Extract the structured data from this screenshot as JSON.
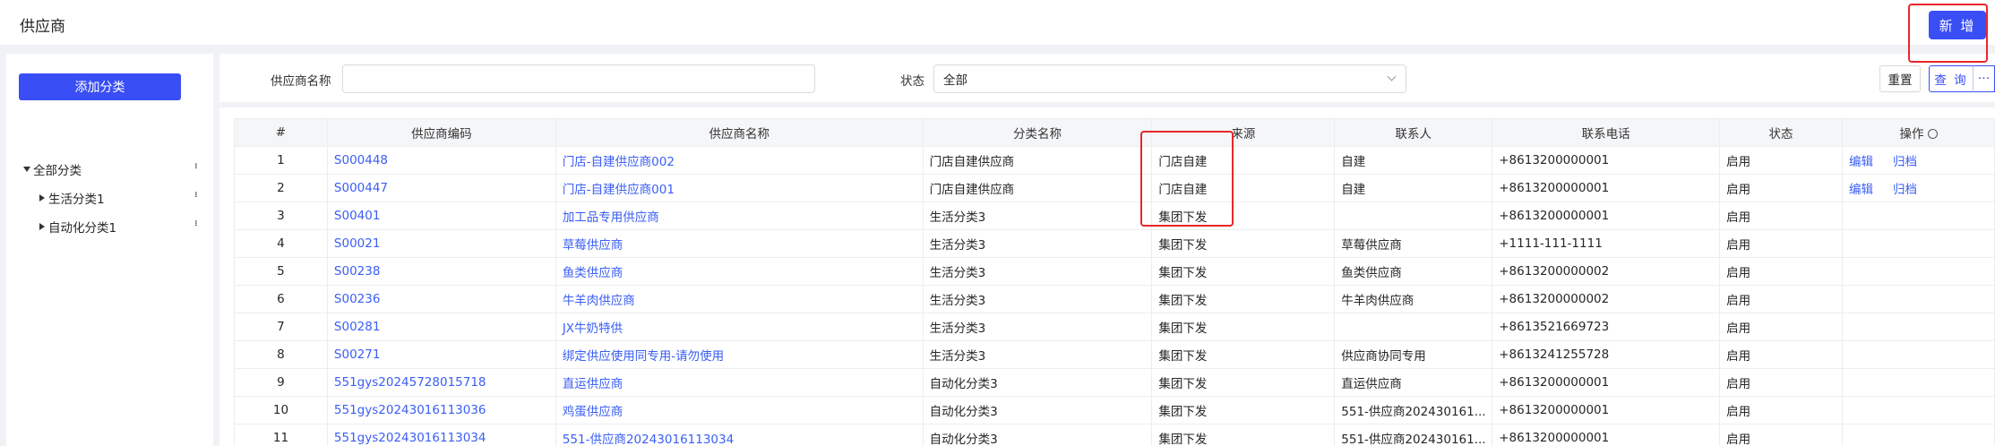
{
  "header": {
    "title": "供应商",
    "new_label": "新 增"
  },
  "sidebar": {
    "add_label": "添加分类",
    "tree": [
      {
        "label": "全部分类",
        "level": 0,
        "expanded": true
      },
      {
        "label": "生活分类1",
        "level": 1,
        "expanded": false
      },
      {
        "label": "自动化分类1",
        "level": 1,
        "expanded": false
      }
    ]
  },
  "filters": {
    "name_label": "供应商名称",
    "name_value": "",
    "status_label": "状态",
    "status_value": "全部",
    "reset_label": "重置",
    "query_label": "查 询",
    "more_label": "···"
  },
  "table": {
    "columns": [
      "#",
      "供应商编码",
      "供应商名称",
      "分类名称",
      "来源",
      "联系人",
      "联系电话",
      "状态",
      "操作"
    ],
    "actions": {
      "edit": "编辑",
      "archive": "归档"
    },
    "rows": [
      {
        "idx": "1",
        "code": "S000448",
        "name": "门店-自建供应商002",
        "category": "门店自建供应商",
        "source": "门店自建",
        "contact": "自建",
        "phone": "+8613200000001",
        "status": "启用",
        "ops": true
      },
      {
        "idx": "2",
        "code": "S000447",
        "name": "门店-自建供应商001",
        "category": "门店自建供应商",
        "source": "门店自建",
        "contact": "自建",
        "phone": "+8613200000001",
        "status": "启用",
        "ops": true
      },
      {
        "idx": "3",
        "code": "S00401",
        "name": "加工品专用供应商",
        "category": "生活分类3",
        "source": "集团下发",
        "contact": "",
        "phone": "+8613200000001",
        "status": "启用",
        "ops": false
      },
      {
        "idx": "4",
        "code": "S00021",
        "name": "草莓供应商",
        "category": "生活分类3",
        "source": "集团下发",
        "contact": "草莓供应商",
        "phone": "+1111-111-1111",
        "status": "启用",
        "ops": false
      },
      {
        "idx": "5",
        "code": "S00238",
        "name": "鱼类供应商",
        "category": "生活分类3",
        "source": "集团下发",
        "contact": "鱼类供应商",
        "phone": "+8613200000002",
        "status": "启用",
        "ops": false
      },
      {
        "idx": "6",
        "code": "S00236",
        "name": "牛羊肉供应商",
        "category": "生活分类3",
        "source": "集团下发",
        "contact": "牛羊肉供应商",
        "phone": "+8613200000002",
        "status": "启用",
        "ops": false
      },
      {
        "idx": "7",
        "code": "S00281",
        "name": "JX牛奶特供",
        "category": "生活分类3",
        "source": "集团下发",
        "contact": "",
        "phone": "+8613521669723",
        "status": "启用",
        "ops": false
      },
      {
        "idx": "8",
        "code": "S00271",
        "name": "绑定供应使用同专用-请勿使用",
        "category": "生活分类3",
        "source": "集团下发",
        "contact": "供应商协同专用",
        "phone": "+8613241255728",
        "status": "启用",
        "ops": false
      },
      {
        "idx": "9",
        "code": "551gys20245728015718",
        "name": "直运供应商",
        "category": "自动化分类3",
        "source": "集团下发",
        "contact": "直运供应商",
        "phone": "+8613200000001",
        "status": "启用",
        "ops": false
      },
      {
        "idx": "10",
        "code": "551gys20243016113036",
        "name": "鸡蛋供应商",
        "category": "自动化分类3",
        "source": "集团下发",
        "contact": "551-供应商202430161...",
        "phone": "+8613200000001",
        "status": "启用",
        "ops": false
      },
      {
        "idx": "11",
        "code": "551gys20243016113034",
        "name": "551-供应商20243016113034",
        "category": "自动化分类3",
        "source": "集团下发",
        "contact": "551-供应商202430161...",
        "phone": "+8613200000001",
        "status": "启用",
        "ops": false
      }
    ]
  },
  "colors": {
    "primary": "#3a4ef5",
    "link": "#3a5ef5",
    "highlight": "#e8262b"
  }
}
